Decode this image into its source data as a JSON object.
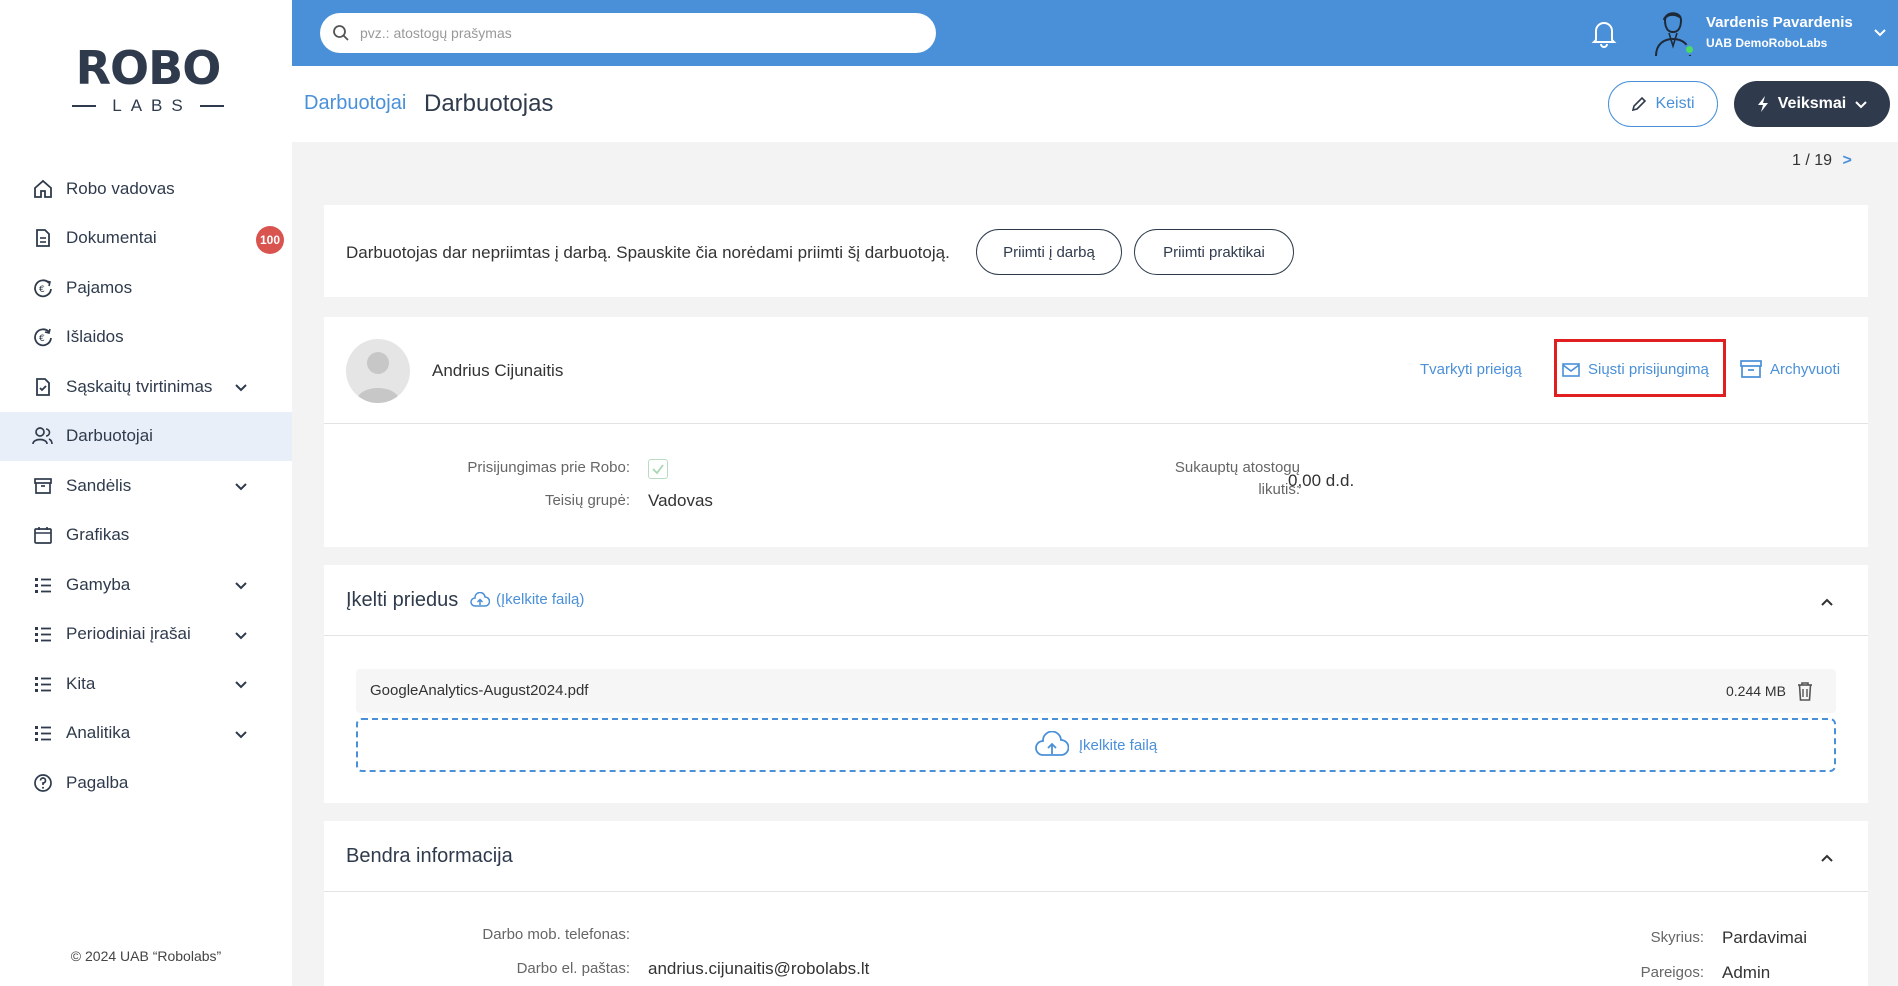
{
  "app": {
    "logo_top": "ROBO",
    "logo_bottom": "LABS",
    "copyright": "© 2024 UAB “Robolabs”"
  },
  "sidebar": {
    "items": [
      {
        "label": "Robo vadovas",
        "icon": "home-icon"
      },
      {
        "label": "Dokumentai",
        "icon": "document-icon",
        "badge": "100"
      },
      {
        "label": "Pajamos",
        "icon": "income-icon"
      },
      {
        "label": "Išlaidos",
        "icon": "expense-icon"
      },
      {
        "label": "Sąskaitų tvirtinimas",
        "icon": "invoice-approval-icon",
        "expandable": true
      },
      {
        "label": "Darbuotojai",
        "icon": "users-icon",
        "active": true
      },
      {
        "label": "Sandėlis",
        "icon": "warehouse-icon",
        "expandable": true
      },
      {
        "label": "Grafikas",
        "icon": "calendar-icon"
      },
      {
        "label": "Gamyba",
        "icon": "list-icon",
        "expandable": true
      },
      {
        "label": "Periodiniai įrašai",
        "icon": "list-icon",
        "expandable": true
      },
      {
        "label": "Kita",
        "icon": "list-icon",
        "expandable": true
      },
      {
        "label": "Analitika",
        "icon": "list-icon",
        "expandable": true
      },
      {
        "label": "Pagalba",
        "icon": "help-icon"
      }
    ]
  },
  "header": {
    "search_placeholder": "pvz.: atostogų prašymas",
    "user_name": "Vardenis Pavardenis",
    "user_company": "UAB DemoRoboLabs"
  },
  "titlebar": {
    "breadcrumb": "Darbuotojai",
    "title": "Darbuotojas",
    "edit_label": "Keisti",
    "actions_label": "Veiksmai"
  },
  "pager": {
    "text": "1 / 19",
    "next": ">"
  },
  "notice": {
    "text": "Darbuotojas dar nepriimtas į darbą. Spauskite čia norėdami priimti šį darbuotoją.",
    "hire_label": "Priimti į darbą",
    "intern_label": "Priimti praktikai"
  },
  "employee": {
    "name": "Andrius Cijunaitis",
    "manage_access": "Tvarkyti prieigą",
    "send_login": "Siųsti prisijungimą",
    "archive": "Archyvuoti",
    "login_label": "Prisijungimas prie Robo:",
    "login_enabled": true,
    "rights_label": "Teisių grupė:",
    "rights_value": "Vadovas",
    "vacation_label_1": "Sukauptų atostogų",
    "vacation_label_2": "likutis:",
    "vacation_value": "0,00 d.d."
  },
  "attachments": {
    "title": "Įkelti priedus",
    "upload_link": "(Įkelkite failą)",
    "file_name": "GoogleAnalytics-August2024.pdf",
    "file_size": "0.244 MB",
    "dropzone_label": "Įkelkite failą"
  },
  "general": {
    "title": "Bendra informacija",
    "phone_label": "Darbo mob. telefonas:",
    "email_label": "Darbo el. paštas:",
    "email_value": "andrius.cijunaitis@robolabs.lt",
    "department_label": "Skyrius:",
    "department_value": "Pardavimai",
    "position_label": "Pareigos:",
    "position_value": "Admin"
  },
  "colors": {
    "accent": "#4a90d9",
    "dark": "#2f3b4c",
    "badge": "#d9534f",
    "highlight": "#e02020"
  }
}
